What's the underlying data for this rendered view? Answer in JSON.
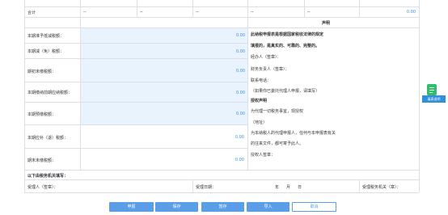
{
  "summary": {
    "label": "合计",
    "cells": [
      "--",
      "--",
      "--",
      "--",
      "--"
    ],
    "total": "0.00"
  },
  "left_rows": [
    {
      "label": "本期准予抵减税额：",
      "value": "0.00"
    },
    {
      "label": "本期减（免）税额：",
      "value": "0.00"
    },
    {
      "label": "期初未缴税额：",
      "value": "0.00"
    },
    {
      "label": "本期缴纳前期应纳税额：",
      "value": "0.00"
    },
    {
      "label": "本期预缴税额：",
      "value": "0.00"
    },
    {
      "label": "本期应补（退）税额：",
      "value": "0.00"
    },
    {
      "label": "期末未缴税额：",
      "value": "0.00"
    }
  ],
  "declaration": {
    "header": "声明",
    "lines": [
      "此纳税申报表是根据国家税收法律的规定",
      "填报的，是真实的、可靠的、完整的。",
      "经办人（签章）：",
      "财务负责人（签章）：",
      "联系电话：",
      "（如果你已委托代理人申报，请填写）",
      "授权声明",
      "为代理一切税务事宜，现授权",
      "（地址）",
      "为本纳税人的代理申报人，任何与本申报表有关",
      "的往来文件，都可寄予此人。",
      "授权人签章："
    ]
  },
  "tax_office": {
    "title": "以下由税务机关填写：",
    "receiver_label": "受理人（签章）：",
    "date_label": "受理日期：",
    "year": "年",
    "month": "月",
    "day": "日",
    "office_label": "受理税务机关（章）："
  },
  "buttons": {
    "submit": "申报",
    "save": "保存",
    "temp_save": "暂存",
    "import": "导入",
    "cancel": "取消"
  },
  "side_widget": {
    "label": "填表说明"
  },
  "colors": {
    "accent": "#3a8ee6",
    "input_bg": "#e9f3fe",
    "button": "#5a9ee8",
    "widget": "#2ebd6b"
  }
}
